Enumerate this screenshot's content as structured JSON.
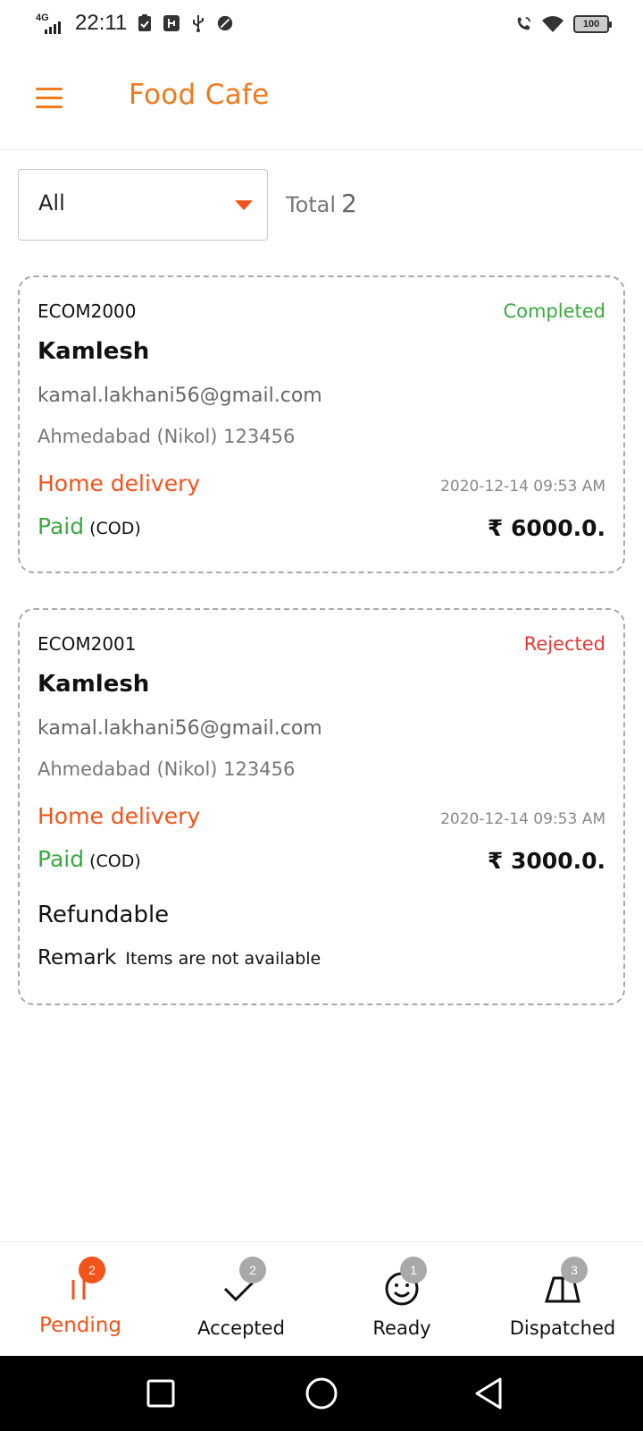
{
  "status_bar": {
    "network": "4G",
    "time": "22:11",
    "battery": "100"
  },
  "app_bar": {
    "title": "Food Cafe",
    "menu_icon": "hamburger-menu-icon",
    "accent_color": "#f07a1e"
  },
  "filter": {
    "selected": "All",
    "total_label": "Total",
    "total_count": "2"
  },
  "orders": [
    {
      "id": "ECOM2000",
      "status": "Completed",
      "status_color": "#3aaa3e",
      "name": "Kamlesh",
      "email": "kamal.lakhani56@gmail.com",
      "address": "Ahmedabad (Nikol) 123456",
      "delivery": "Home delivery",
      "date": "2020-12-14 09:53 AM",
      "payment": "Paid",
      "method": "(COD)",
      "amount": "₹ 6000.0."
    },
    {
      "id": "ECOM2001",
      "status": "Rejected",
      "status_color": "#e53935",
      "name": "Kamlesh",
      "email": "kamal.lakhani56@gmail.com",
      "address": "Ahmedabad (Nikol) 123456",
      "delivery": "Home delivery",
      "date": "2020-12-14 09:53 AM",
      "payment": "Paid",
      "method": "(COD)",
      "amount": "₹ 3000.0.",
      "refund": "Refundable",
      "remark_label": "Remark",
      "remark": "Items are not available"
    }
  ],
  "bottom_nav": [
    {
      "label": "Pending",
      "badge": "2",
      "icon": "pending-icon",
      "active": true
    },
    {
      "label": "Accepted",
      "badge": "2",
      "icon": "check-icon",
      "active": false
    },
    {
      "label": "Ready",
      "badge": "1",
      "icon": "smiley-icon",
      "active": false
    },
    {
      "label": "Dispatched",
      "badge": "3",
      "icon": "dispatch-icon",
      "active": false
    }
  ],
  "colors": {
    "active_nav": "#f2541b",
    "badge_inactive": "#a9a9a9"
  }
}
